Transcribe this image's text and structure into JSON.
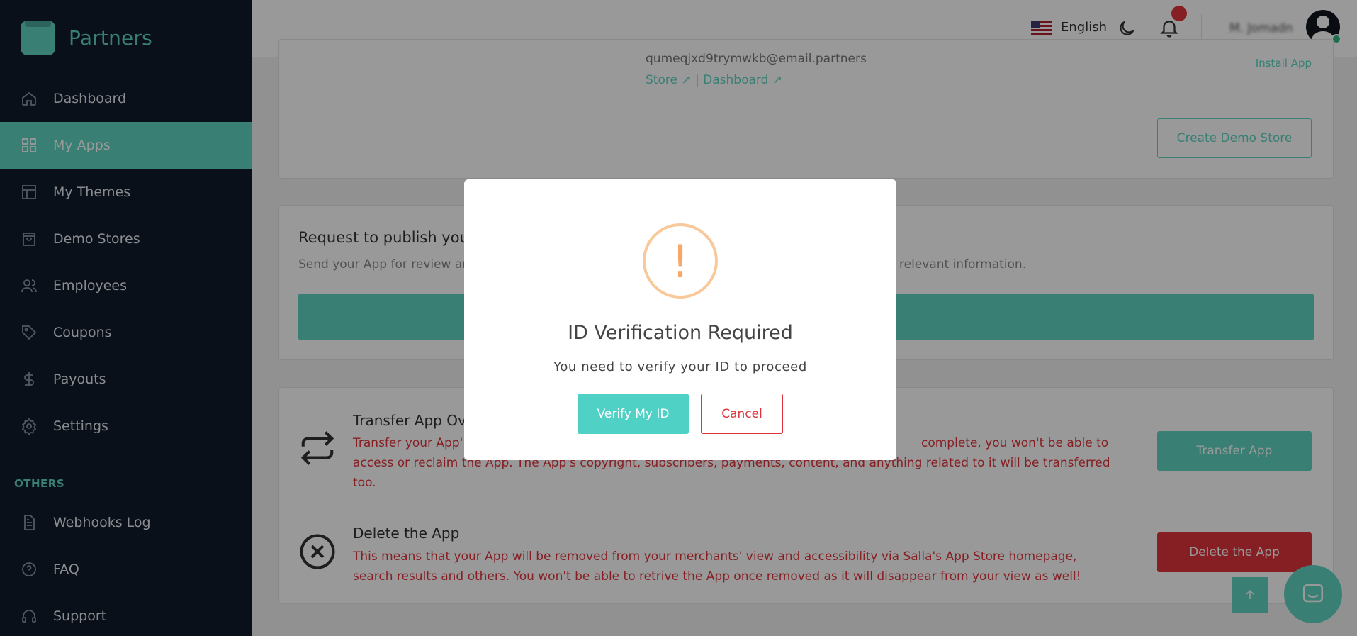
{
  "brand": {
    "name": "Partners"
  },
  "sidebar": {
    "items": [
      {
        "label": "Dashboard",
        "icon": "home-icon"
      },
      {
        "label": "My Apps",
        "icon": "grid-icon",
        "active": true
      },
      {
        "label": "My Themes",
        "icon": "layout-icon"
      },
      {
        "label": "Demo Stores",
        "icon": "bag-icon"
      },
      {
        "label": "Employees",
        "icon": "users-icon"
      },
      {
        "label": "Coupons",
        "icon": "tag-icon"
      },
      {
        "label": "Payouts",
        "icon": "dollar-icon"
      },
      {
        "label": "Settings",
        "icon": "gear-icon"
      }
    ],
    "section_label": "OTHERS",
    "other_items": [
      {
        "label": "Webhooks Log",
        "icon": "document-icon"
      },
      {
        "label": "FAQ",
        "icon": "help-icon"
      },
      {
        "label": "Support",
        "icon": "headset-icon"
      }
    ]
  },
  "topbar": {
    "language": "English",
    "username": "M. Jomadn"
  },
  "demo_store": {
    "email": "qumeqjxd9trymwkb@email.partners",
    "store_link": "Store",
    "separator": "|",
    "dashboard_link": "Dashboard",
    "install_link": "Install App",
    "create_button": "Create Demo Store"
  },
  "publish": {
    "title": "Request to publish you",
    "desc_left": "Send your App for review ar",
    "desc_right": "relevant information."
  },
  "transfer": {
    "title": "Transfer App Ov",
    "desc": "Transfer your App' complete, you won't be able to access or reclaim the App. The App's copyright, subscribers, payments, content, and anything related to it will be transferred too.",
    "desc_line1": "Transfer your App'",
    "desc_line1_right": "complete, you won't be able to",
    "desc_line2": "access or reclaim the App. The App's copyright, subscribers, payments, content, and anything related to it will be transferred",
    "desc_line3": "too.",
    "button": "Transfer App"
  },
  "delete": {
    "title": "Delete the App",
    "desc": "This means that your App will be removed from your merchants' view and accessibility via Salla's App Store homepage, search results and others. You won't be able to retrive the App once removed as it will disappear from your view as well!",
    "button": "Delete the App"
  },
  "modal": {
    "icon": "!",
    "title": "ID Verification Required",
    "text": "You need to verify your ID to proceed",
    "confirm": "Verify My ID",
    "cancel": "Cancel"
  },
  "colors": {
    "accent": "#5fd4c1",
    "danger": "#e0343d",
    "sidebar_bg": "#0f1b2a",
    "warning": "#f6a866"
  }
}
